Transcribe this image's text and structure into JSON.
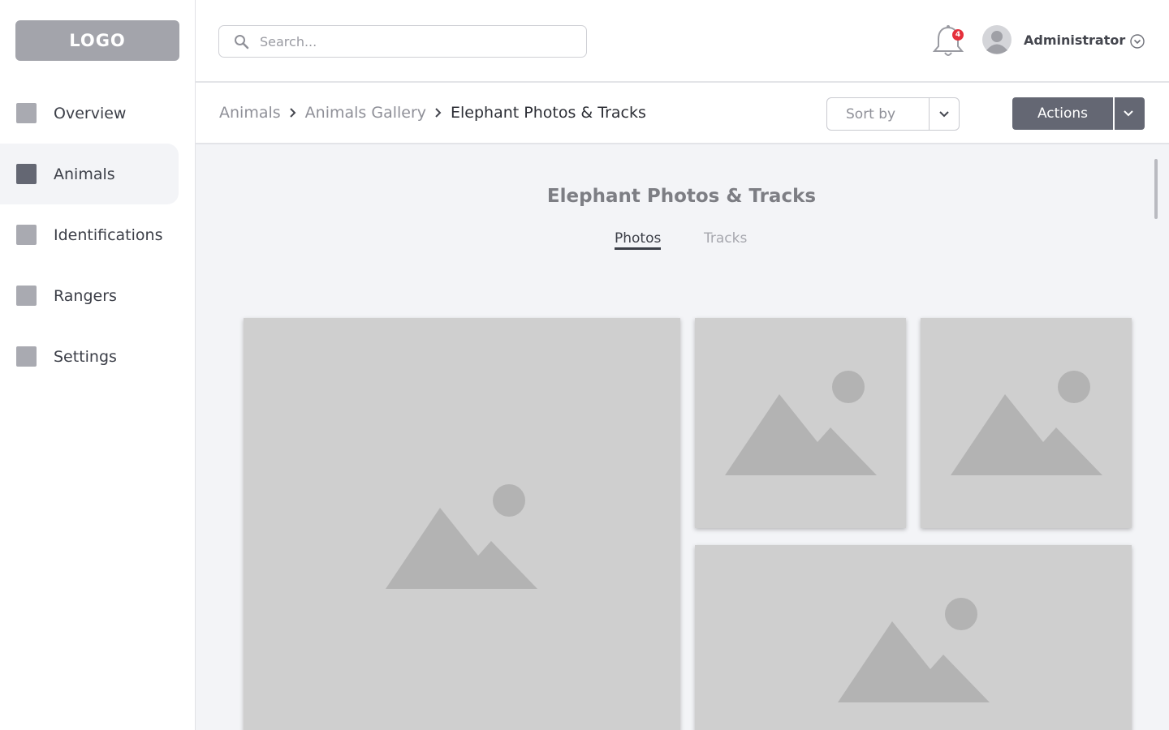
{
  "sidebar": {
    "logo": "LOGO",
    "items": [
      {
        "label": "Overview",
        "active": false
      },
      {
        "label": "Animals",
        "active": true
      },
      {
        "label": "Identifications",
        "active": false
      },
      {
        "label": "Rangers",
        "active": false
      },
      {
        "label": "Settings",
        "active": false
      }
    ]
  },
  "header": {
    "search": {
      "placeholder": "Search...",
      "value": ""
    },
    "notifications": {
      "count": "4"
    },
    "user": {
      "name": "Administrator"
    }
  },
  "breadcrumb": {
    "items": [
      "Animals",
      "Animals Gallery",
      "Elephant Photos & Tracks"
    ]
  },
  "toolbar": {
    "sort_label": "Sort by",
    "actions_label": "Actions"
  },
  "main": {
    "title": "Elephant Photos & Tracks",
    "tabs": [
      {
        "label": "Photos",
        "active": true
      },
      {
        "label": "Tracks",
        "active": false
      }
    ]
  },
  "colors": {
    "accent": "#646773",
    "badge": "#e5303b",
    "placeholder_fill": "#cfcfcf"
  },
  "icons": [
    "search-icon",
    "bell-icon",
    "user-avatar-icon",
    "chevron-down-icon",
    "chevron-right-icon",
    "image-placeholder-icon"
  ]
}
